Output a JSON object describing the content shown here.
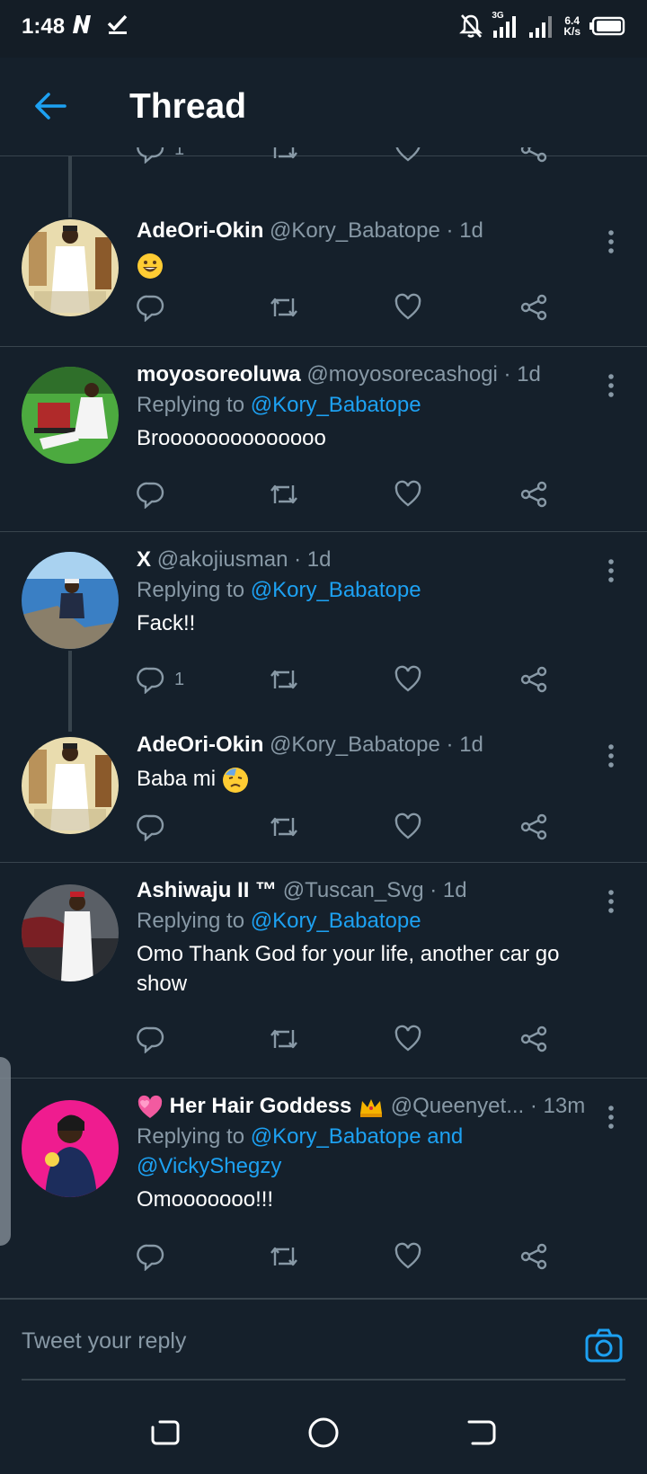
{
  "status_bar": {
    "time": "1:48",
    "network": "3G",
    "speed_value": "6.4",
    "speed_unit": "K/s"
  },
  "header": {
    "title": "Thread"
  },
  "top_partial": {
    "reply_count": "1"
  },
  "tweets": [
    {
      "name": "AdeOri-Okin",
      "handle": "@Kory_Babatope",
      "time": "· 1d",
      "replying_label": "",
      "replying_to": "",
      "text": "",
      "emoji": "grinning-face",
      "reply_count": ""
    },
    {
      "name": "moyosoreoluwa",
      "handle": "@moyosorecashogi",
      "time": "· 1d",
      "replying_label": "Replying to",
      "replying_to": "@Kory_Babatope",
      "text": "Broooooooooooooo",
      "reply_count": ""
    },
    {
      "name": "X",
      "handle": "@akojiusman",
      "time": "· 1d",
      "replying_label": "Replying to",
      "replying_to": "@Kory_Babatope",
      "text": "Fack!!",
      "reply_count": "1"
    },
    {
      "name": "AdeOri-Okin",
      "handle": "@Kory_Babatope",
      "time": "· 1d",
      "replying_label": "",
      "replying_to": "",
      "text": "Baba mi",
      "emoji": "downcast-sweat-face",
      "reply_count": ""
    },
    {
      "name": "Ashiwaju II ™",
      "handle": "@Tuscan_Svg",
      "time": "· 1d",
      "replying_label": "Replying to",
      "replying_to": "@Kory_Babatope",
      "text": "Omo Thank God for your life, another car go show",
      "reply_count": ""
    },
    {
      "name": "Her Hair Goddess",
      "handle": "@Queenyet...",
      "time": "· 13m",
      "replying_label": "Replying to",
      "replying_to": "@Kory_Babatope and @VickyShegzy",
      "text": "Omooooooo!!!",
      "reply_count": ""
    }
  ],
  "reply_box": {
    "placeholder": "Tweet your reply"
  },
  "colors": {
    "background": "#15202b",
    "accent": "#1da1f2",
    "secondary_text": "#8899a6",
    "divider": "#38444d"
  }
}
